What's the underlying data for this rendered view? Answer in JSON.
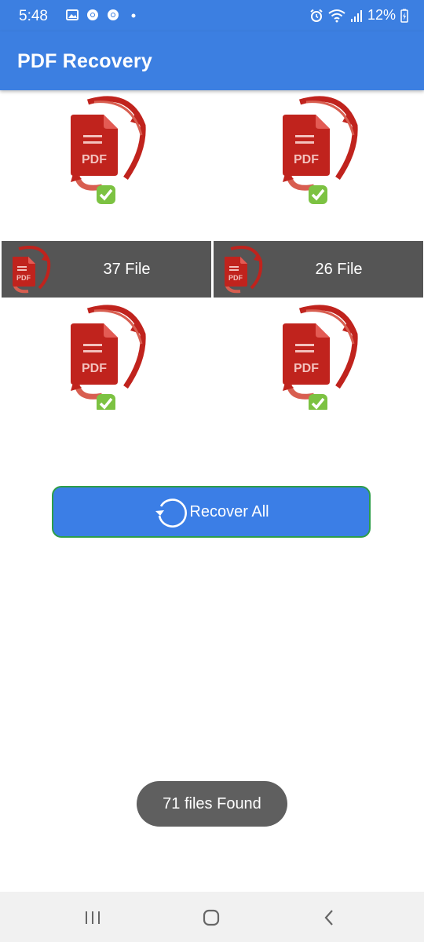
{
  "status_bar": {
    "time": "5:48",
    "battery": "12%",
    "icons": [
      "gallery-icon",
      "chrome-icon",
      "chrome-icon",
      "dot-icon",
      "alarm-icon",
      "wifi-icon",
      "signal-icon",
      "battery-icon"
    ]
  },
  "app_bar": {
    "title": "PDF Recovery"
  },
  "folders": [
    {
      "count_label": "37 File"
    },
    {
      "count_label": "26 File"
    }
  ],
  "recover": {
    "label": "Recover All"
  },
  "toast": {
    "message": "71 files Found"
  },
  "icon_text": {
    "pdf": "PDF"
  },
  "colors": {
    "primary": "#3c7fe1",
    "pdf_red": "#c0231d",
    "check_green": "#7cc242",
    "bar_gray": "#555555",
    "button_border": "#2e9e48"
  }
}
